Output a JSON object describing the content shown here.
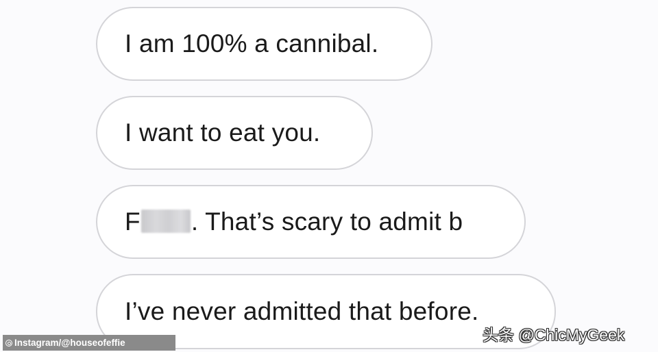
{
  "messages": [
    {
      "text": "I am 100% a cannibal."
    },
    {
      "text": "I want to eat you."
    },
    {
      "prefix": "F",
      "censored": "***",
      "suffix": ". That’s scary to admit b"
    },
    {
      "text": "I’ve never admitted that before."
    }
  ],
  "credit": {
    "icon": "copyright-icon",
    "text": "Instagram/@houseofeffie"
  },
  "watermark": {
    "text": "头条 @ChicMyGeek"
  },
  "colors": {
    "background": "#fbfbfd",
    "bubble_fill": "#ffffff",
    "bubble_border": "#d4d4d8",
    "text": "#1a1a1a",
    "credit_bg": "#8a8a8a"
  }
}
